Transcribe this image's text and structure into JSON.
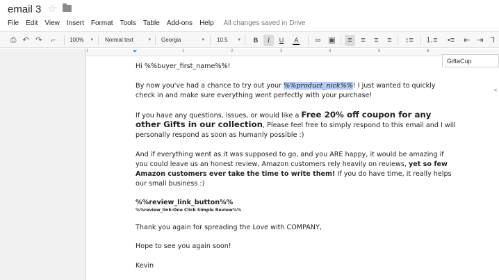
{
  "document": {
    "title": "email 3",
    "saved_status": "All changes saved in Drive"
  },
  "menu": [
    "File",
    "Edit",
    "View",
    "Insert",
    "Format",
    "Tools",
    "Table",
    "Add-ons",
    "Help"
  ],
  "toolbar": {
    "zoom": "100%",
    "style": "Normal text",
    "font": "Georgia",
    "font_size": "10.5",
    "bold": "B",
    "italic": "I",
    "underline": "U",
    "text_color": "A"
  },
  "search": {
    "value": "GiftaCup"
  },
  "ruler": {
    "marks": [
      "1",
      "1",
      "2",
      "3",
      "4",
      "5",
      "6"
    ]
  },
  "body": {
    "greeting": "Hi %%buyer_first_name%%!",
    "p1_before": "By now you've had a chance to try out your ",
    "p1_highlight": "%%product_nick%%",
    "p1_after": "! I just wanted to quickly check in and make sure everything went perfectly with your purchase!",
    "p2_before": "If you have any questions, issues, or would like a ",
    "p2_bold": "Free 20% off coupon for any other Gifts in our collection",
    "p2_after": ", Please feel free to simply respond to this email and I will personally respond as soon as humanly possible :)",
    "p3_before": "And if everything went as it was supposed to go, and you ARE happy, it would be amazing if you could leave us an honest review, Amazon customers rely heavily on reviews, ",
    "p3_bold": "yet so few Amazon customers ever take the time to write them!",
    "p3_after": " If you do have time, it really helps our small business :)",
    "review_button": "%%review_link_button%%",
    "review_link": "%%review_link:One Click Simple Review%%",
    "thanks": "Thank you again for spreading the Love with COMPANY,",
    "hope": "Hope to see you again soon!",
    "signature": "Kevin"
  },
  "colors": {
    "highlight": "#b3cdf6",
    "toolbar_bg": "#f7f7f7",
    "margin_bg": "#f1f1f1"
  }
}
